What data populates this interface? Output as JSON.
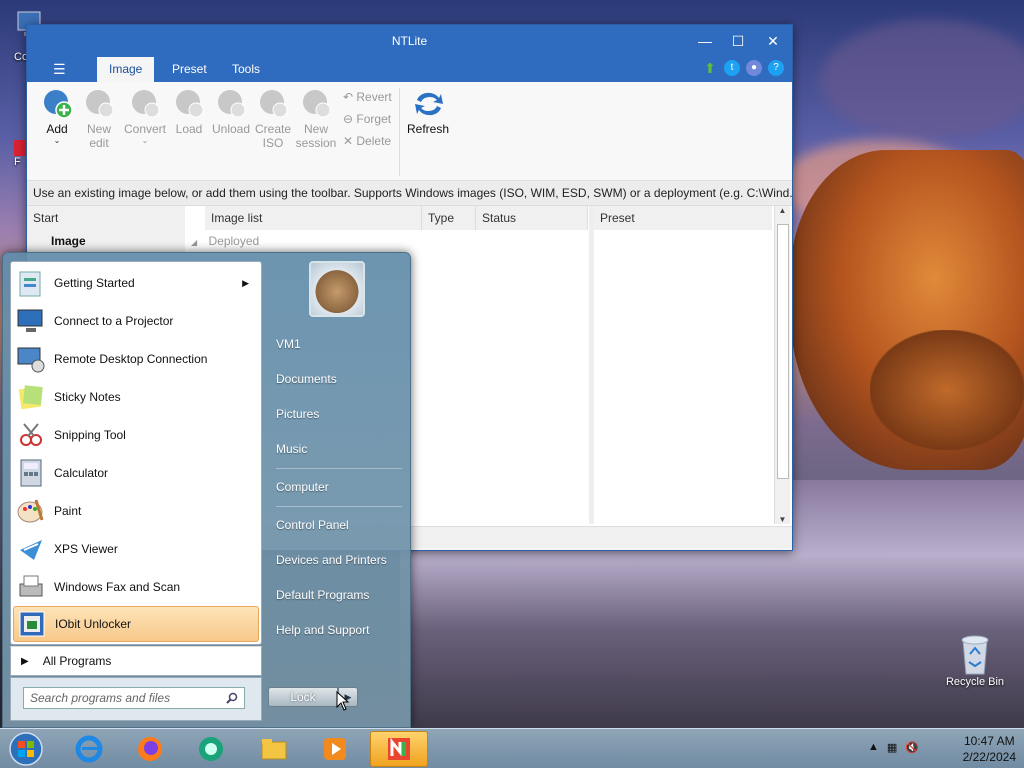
{
  "desktop": {
    "recycle_bin_label": "Recycle Bin",
    "partial_label_1": "Co",
    "partial_label_2": "F"
  },
  "ntlite": {
    "title": "NTLite",
    "window_buttons": {
      "minimize": "—",
      "maximize": "☐",
      "close": "✕"
    },
    "menu_icon": "☰",
    "tabs": [
      {
        "label": "Image",
        "active": true
      },
      {
        "label": "Preset",
        "active": false
      },
      {
        "label": "Tools",
        "active": false
      }
    ],
    "top_icons": [
      "update-arrow-icon",
      "twitter-icon",
      "discord-icon",
      "help-icon"
    ],
    "toolbar": {
      "add": "Add",
      "new_edit_1": "New",
      "new_edit_2": "edit",
      "convert": "Convert",
      "load": "Load",
      "unload": "Unload",
      "create_iso_1": "Create",
      "create_iso_2": "ISO",
      "new_session_1": "New",
      "new_session_2": "session",
      "revert": "Revert",
      "forget": "Forget",
      "delete": "Delete",
      "refresh": "Refresh"
    },
    "hint": "Use an existing image below, or add them using the toolbar. Supports Windows images (ISO, WIM, ESD, SWM) or a deployment (e.g. C:\\Wind...",
    "columns": {
      "start": "Start",
      "image_list": "Image list",
      "type": "Type",
      "status": "Status",
      "preset": "Preset"
    },
    "left_item": "Image",
    "tree_group": "Deployed"
  },
  "start_menu": {
    "programs": [
      {
        "label": "Getting Started",
        "icon": "getting-started-icon",
        "has_submenu": true
      },
      {
        "label": "Connect to a Projector",
        "icon": "projector-icon"
      },
      {
        "label": "Remote Desktop Connection",
        "icon": "remote-desktop-icon"
      },
      {
        "label": "Sticky Notes",
        "icon": "sticky-notes-icon"
      },
      {
        "label": "Snipping Tool",
        "icon": "snipping-tool-icon"
      },
      {
        "label": "Calculator",
        "icon": "calculator-icon"
      },
      {
        "label": "Paint",
        "icon": "paint-icon"
      },
      {
        "label": "XPS Viewer",
        "icon": "xps-viewer-icon"
      },
      {
        "label": "Windows Fax and Scan",
        "icon": "fax-scan-icon"
      },
      {
        "label": "IObit Unlocker",
        "icon": "iobit-unlocker-icon",
        "highlighted": true
      }
    ],
    "all_programs": "All Programs",
    "search_placeholder": "Search programs and files",
    "right_items": [
      "VM1",
      "Documents",
      "Pictures",
      "Music",
      "Computer",
      "Control Panel",
      "Devices and Printers",
      "Default Programs",
      "Help and Support"
    ],
    "lock_label": "Lock"
  },
  "taskbar": {
    "apps": [
      "start-orb-icon",
      "internet-explorer-icon",
      "firefox-icon",
      "browser-icon",
      "file-explorer-icon",
      "media-player-icon",
      "ntlite-icon"
    ],
    "time": "10:47 AM",
    "date": "2/22/2024"
  }
}
